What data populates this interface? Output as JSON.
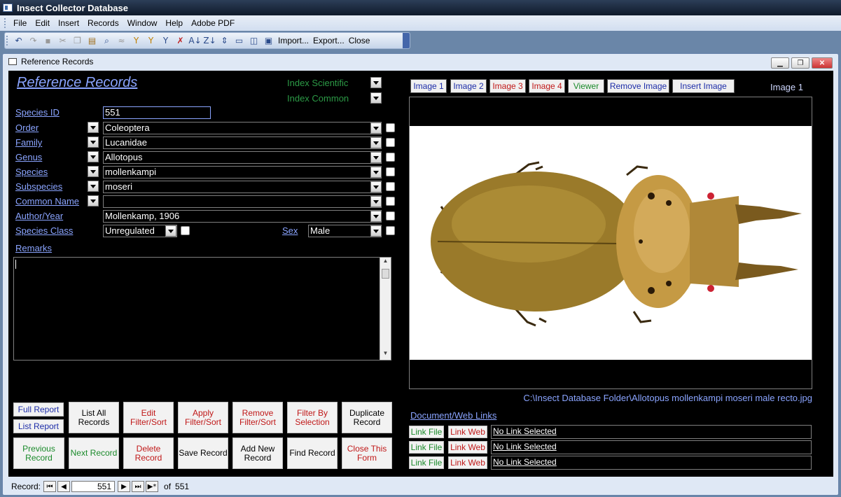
{
  "app": {
    "title": "Insect Collector Database"
  },
  "menu": [
    "File",
    "Edit",
    "Insert",
    "Records",
    "Window",
    "Help",
    "Adobe PDF"
  ],
  "toolbar": {
    "import_label": "Import...",
    "export_label": "Export...",
    "close_label": "Close"
  },
  "form": {
    "window_title": "Reference Records",
    "heading": "Reference Records",
    "index_scientific": "Index Scientific",
    "index_common": "Index Common",
    "labels": {
      "species_id": "Species ID",
      "order": "Order",
      "family": "Family",
      "genus": "Genus",
      "species": "Species",
      "subspecies": "Subspecies",
      "common_name": "Common Name",
      "author_year": "Author/Year",
      "species_class": "Species Class",
      "sex": "Sex",
      "remarks": "Remarks"
    },
    "values": {
      "species_id": "551",
      "order": "Coleoptera",
      "family": "Lucanidae",
      "genus": "Allotopus",
      "species": "mollenkampi",
      "subspecies": "moseri",
      "common_name": "",
      "author_year": "Mollenkamp, 1906",
      "species_class": "Unregulated",
      "sex": "Male",
      "remarks": ""
    }
  },
  "image_tabs": {
    "image1": "Image 1",
    "image2": "Image 2",
    "image3": "Image 3",
    "image4": "Image 4",
    "viewer": "Viewer",
    "remove": "Remove Image",
    "insert": "Insert Image",
    "current": "Image 1"
  },
  "image_path": "C:\\Insect Database Folder\\Allotopus mollenkampi moseri male recto.jpg",
  "links": {
    "heading": "Document/Web Links",
    "link_file": "Link File",
    "link_web": "Link Web",
    "rows": [
      "No Link Selected",
      "No Link Selected",
      "No Link Selected"
    ]
  },
  "buttons": {
    "full_report": "Full Report",
    "list_report": "List Report",
    "list_all": "List All Records",
    "edit_filter": "Edit Filter/Sort",
    "apply_filter": "Apply Filter/Sort",
    "remove_filter": "Remove Filter/Sort",
    "filter_selection": "Filter By Selection",
    "duplicate": "Duplicate Record",
    "previous": "Previous Record",
    "next": "Next Record",
    "delete": "Delete Record",
    "save": "Save Record",
    "add_new": "Add New Record",
    "find": "Find Record",
    "close_form": "Close This Form"
  },
  "record_nav": {
    "label": "Record:",
    "current": "551",
    "of_label": "of",
    "total": "551"
  },
  "colors": {
    "accent_label": "#8aa4ff",
    "index_green": "#2c9a46",
    "form_bg": "#000000"
  }
}
